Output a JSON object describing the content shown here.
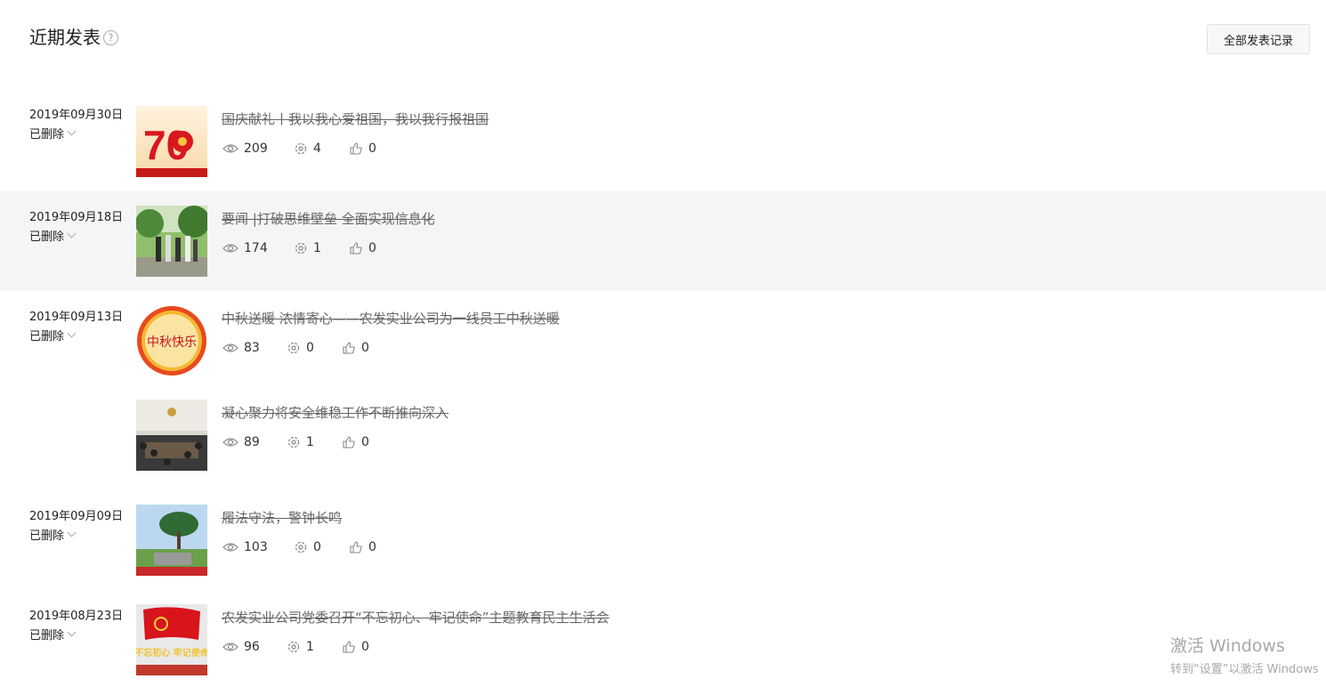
{
  "header": {
    "title": "近期发表",
    "help": "?",
    "all_button": "全部发表记录"
  },
  "posts": [
    {
      "date": "2019年09月30日",
      "status": "已删除",
      "title": "国庆献礼丨我以我心爱祖国，我以我行报祖国",
      "views": "209",
      "shares": "4",
      "likes": "0",
      "thumb_text": "70"
    },
    {
      "date": "2019年09月18日",
      "status": "已删除",
      "title": "要闻 |打破思维壁垒 全面实现信息化",
      "views": "174",
      "shares": "1",
      "likes": "0"
    },
    {
      "date": "2019年09月13日",
      "status": "已删除",
      "title": "中秋送暖 浓情寄心——农发实业公司为一线员工中秋送暖",
      "views": "83",
      "shares": "0",
      "likes": "0",
      "thumb_text": "中秋快乐"
    },
    {
      "date": "",
      "status": "",
      "title": "凝心聚力将安全维稳工作不断推向深入",
      "views": "89",
      "shares": "1",
      "likes": "0"
    },
    {
      "date": "2019年09月09日",
      "status": "已删除",
      "title": "履法守法，警钟长鸣",
      "views": "103",
      "shares": "0",
      "likes": "0"
    },
    {
      "date": "2019年08月23日",
      "status": "已删除",
      "title": "农发实业公司党委召开“不忘初心、牢记使命”主题教育民主生活会",
      "views": "96",
      "shares": "1",
      "likes": "0",
      "thumb_text": "不忘初心 牢记使命"
    }
  ],
  "icons": {
    "views": "eye-icon",
    "shares": "share-gear-icon",
    "likes": "thumbs-up-icon"
  },
  "watermark": {
    "line1": "激活 Windows",
    "line2": "转到“设置”以激活 Windows"
  }
}
